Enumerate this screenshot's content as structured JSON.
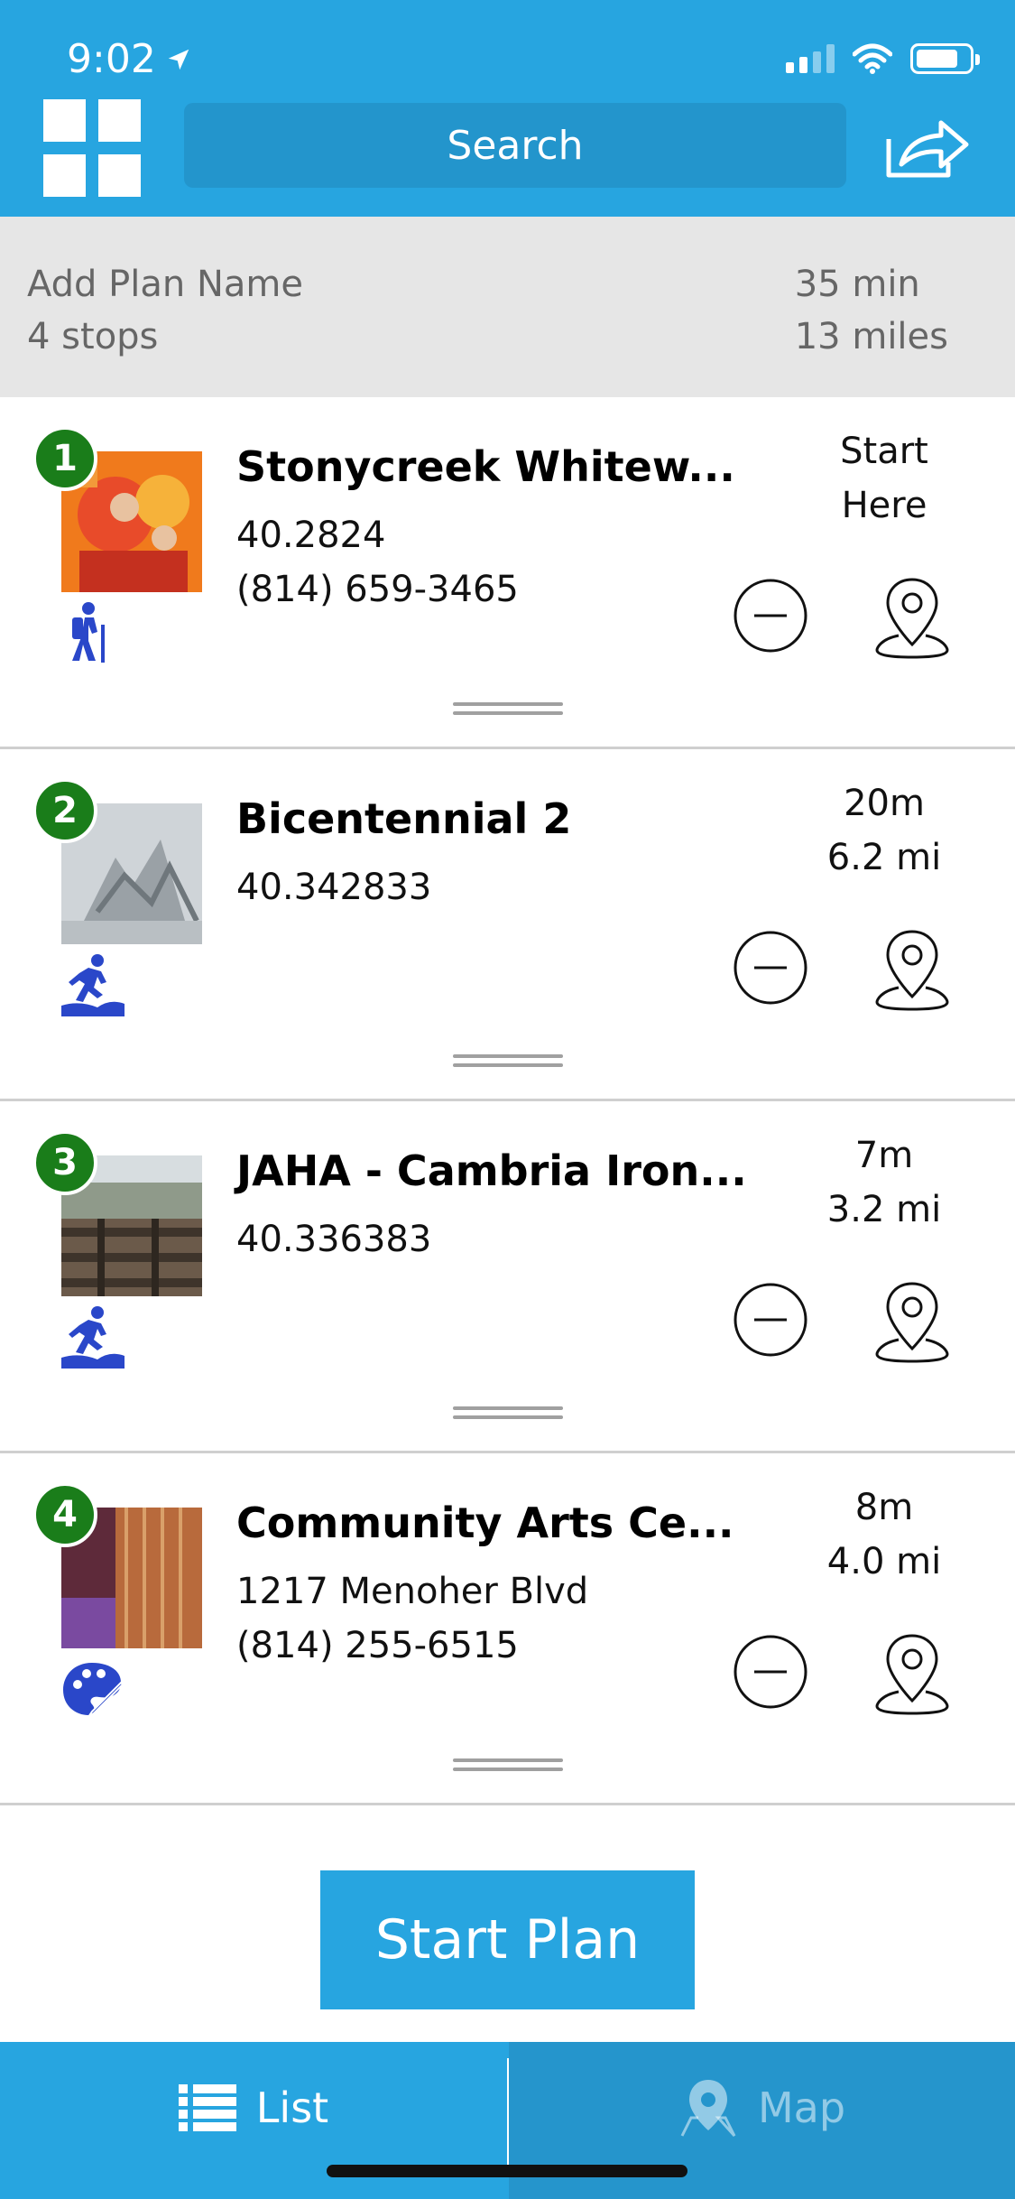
{
  "status": {
    "time": "9:02"
  },
  "header": {
    "search_label": "Search"
  },
  "plan": {
    "name_placeholder": "Add Plan Name",
    "stops_label": "4 stops",
    "duration": "35 min",
    "distance": "13 miles"
  },
  "stops": [
    {
      "number": "1",
      "name": "Stonycreek Whitew...",
      "line1": "40.2824",
      "line2": "(814) 659-3465",
      "meta1": "Start",
      "meta2": "Here",
      "category_icon": "hiking-icon"
    },
    {
      "number": "2",
      "name": "Bicentennial 2",
      "line1": "40.342833",
      "line2": "",
      "meta1": "20m",
      "meta2": "6.2 mi",
      "category_icon": "running-trail-icon"
    },
    {
      "number": "3",
      "name": "JAHA - Cambria Iron...",
      "line1": "40.336383",
      "line2": "",
      "meta1": "7m",
      "meta2": "3.2 mi",
      "category_icon": "running-trail-icon"
    },
    {
      "number": "4",
      "name": "Community Arts Ce...",
      "line1": "1217 Menoher Blvd",
      "line2": "(814) 255-6515",
      "meta1": "8m",
      "meta2": "4.0 mi",
      "category_icon": "art-palette-icon"
    }
  ],
  "actions": {
    "start_plan": "Start Plan"
  },
  "tabs": {
    "list": "List",
    "map": "Map"
  },
  "colors": {
    "brand_blue": "#27a5e0",
    "badge_green": "#1a7d1a",
    "icon_blue": "#2a47c9"
  }
}
